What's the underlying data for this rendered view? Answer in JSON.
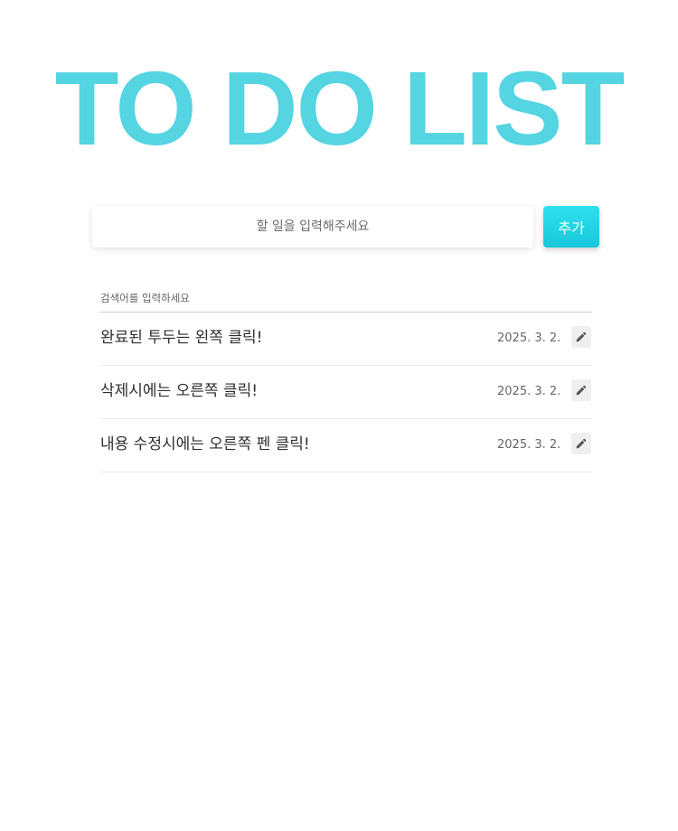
{
  "header": {
    "title": "TO DO LIST"
  },
  "add_form": {
    "input_placeholder": "할 일을 입력해주세요",
    "input_value": "",
    "add_label": "추가"
  },
  "search": {
    "placeholder": "검색어를 입력하세요",
    "value": ""
  },
  "todos": [
    {
      "text": "완료된 투두는 왼쪽 클릭!",
      "date": "2025. 3. 2.",
      "edit_icon": "pencil-icon"
    },
    {
      "text": "삭제시에는 오른쪽 클릭!",
      "date": "2025. 3. 2.",
      "edit_icon": "pencil-icon"
    },
    {
      "text": "내용 수정시에는 오른쪽 펜 클릭!",
      "date": "2025. 3. 2.",
      "edit_icon": "pencil-icon"
    }
  ],
  "colors": {
    "title": "#55d4e1",
    "accent": "#1ccfe0",
    "edit_icon": "#555555"
  }
}
